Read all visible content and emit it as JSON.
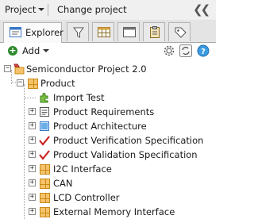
{
  "topbar": {
    "project_label": "Project",
    "change_project_label": "Change project"
  },
  "tabs": {
    "explorer_label": "Explorer"
  },
  "toolbar": {
    "add_label": "Add"
  },
  "tree": {
    "root": "Semiconductor Project 2.0",
    "product": "Product",
    "items": [
      "Import Test",
      "Product Requirements",
      "Product Architecture",
      "Product Verification Specification",
      "Product Validation Specification",
      "I2C Interface",
      "CAN",
      "LCD Controller",
      "External Memory Interface"
    ]
  },
  "colors": {
    "folder": "#f5c36b",
    "check_red": "#cc2222",
    "add_green": "#2d8a2d",
    "accent_blue": "#3a78c8"
  }
}
